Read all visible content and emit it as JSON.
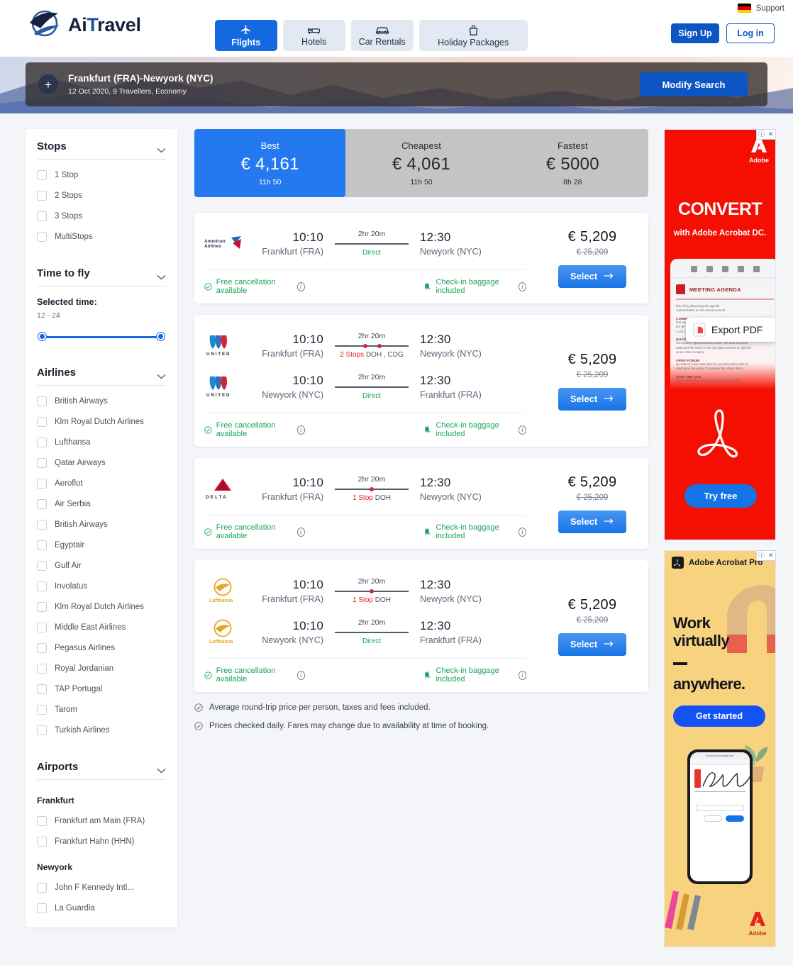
{
  "header": {
    "support_label": "Support",
    "flag_icon": "germany-flag",
    "brand_ai": "Ai",
    "brand_t": "T",
    "brand_ravel": "ravel",
    "tabs": [
      {
        "label": "Flights",
        "icon": "plane-icon",
        "active": true
      },
      {
        "label": "Hotels",
        "icon": "bed-icon",
        "active": false
      },
      {
        "label": "Car Rentals",
        "icon": "car-icon",
        "active": false
      },
      {
        "label": "Holiday Packages",
        "icon": "bag-icon",
        "active": false
      }
    ],
    "sign_up": "Sign Up",
    "log_in": "Log in"
  },
  "hero": {
    "add_icon": "plus-icon",
    "route": "Frankfurt (FRA)-Newyork (NYC)",
    "details": "12 Oct 2020, 9 Travellers, Economy",
    "modify_button": "Modify Search"
  },
  "sidebar": {
    "stops": {
      "title": "Stops",
      "options": [
        "1 Stop",
        "2 Stops",
        "3 Stops",
        "MultiStops"
      ]
    },
    "time_to_fly": {
      "title": "Time to fly",
      "selected_label": "Selected time:",
      "selected_value": "12 - 24",
      "range_min": 12,
      "range_max": 24
    },
    "airlines": {
      "title": "Airlines",
      "options": [
        "British Airways",
        "Klm Royal Dutch Airlines",
        "Lufthansa",
        "Qatar Airways",
        "Aeroflot",
        "Air Serbia",
        "British Airways",
        "Egyptair",
        "Gulf Air",
        "Involatus",
        "Klm Royal Dutch Airlines",
        "Middle East Airlines",
        "Pegasus Airlines",
        "Royal Jordanian",
        "TAP Portugal",
        "Tarom",
        "Turkish Airlines"
      ]
    },
    "airports": {
      "title": "Airports",
      "groups": [
        {
          "city": "Frankfurt",
          "options": [
            "Frankfurt am Main (FRA)",
            "Frankfurt Hahn (HHN)"
          ]
        },
        {
          "city": "Newyork",
          "options": [
            "John F Kennedy Intl...",
            "La Guardia"
          ]
        }
      ]
    }
  },
  "price_tabs": [
    {
      "label": "Best",
      "price": "€ 4,161",
      "duration": "11h 50",
      "active": true
    },
    {
      "label": "Cheapest",
      "price": "€ 4,061",
      "duration": "11h 50",
      "active": false
    },
    {
      "label": "Fastest",
      "price": "€ 5000",
      "duration": "8h 28",
      "active": false
    }
  ],
  "flights": [
    {
      "airline": "American Airlines",
      "airline_logo": "american-airlines-logo",
      "legs": [
        {
          "depart_time": "10:10",
          "depart_city": "Frankfurt (FRA)",
          "duration": "2hr 20m",
          "stops_label": "Direct",
          "stops_count": 0,
          "stop_codes": "",
          "arrive_time": "12:30",
          "arrive_city": "Newyork (NYC)"
        }
      ],
      "price": "€ 5,209",
      "price_old": "€ 25,209",
      "select_label": "Select",
      "features": [
        {
          "text": "Free cancellation available",
          "icon": "check-circle-icon"
        },
        {
          "text": "Check-in baggage included",
          "icon": "baggage-icon"
        }
      ]
    },
    {
      "airline": "United",
      "airline_logo": "united-logo",
      "legs": [
        {
          "depart_time": "10:10",
          "depart_city": "Frankfurt (FRA)",
          "duration": "2hr 20m",
          "stops_label": "2 Stops",
          "stops_count": 2,
          "stop_codes": "DOH , CDG",
          "arrive_time": "12:30",
          "arrive_city": "Newyork (NYC)"
        },
        {
          "depart_time": "10:10",
          "depart_city": "Newyork (NYC)",
          "duration": "2hr 20m",
          "stops_label": "Direct",
          "stops_count": 0,
          "stop_codes": "",
          "arrive_time": "12:30",
          "arrive_city": "Frankfurt (FRA)"
        }
      ],
      "price": "€ 5,209",
      "price_old": "€ 25,209",
      "select_label": "Select",
      "features": [
        {
          "text": "Free cancellation available",
          "icon": "check-circle-icon"
        },
        {
          "text": "Check-in baggage included",
          "icon": "baggage-icon"
        }
      ]
    },
    {
      "airline": "Delta",
      "airline_logo": "delta-logo",
      "legs": [
        {
          "depart_time": "10:10",
          "depart_city": "Frankfurt (FRA)",
          "duration": "2hr 20m",
          "stops_label": "1 Stop",
          "stops_count": 1,
          "stop_codes": "DOH",
          "arrive_time": "12:30",
          "arrive_city": "Newyork (NYC)"
        }
      ],
      "price": "€ 5,209",
      "price_old": "€ 25,209",
      "select_label": "Select",
      "features": [
        {
          "text": "Free cancellation available",
          "icon": "check-circle-icon"
        },
        {
          "text": "Check-in baggage included",
          "icon": "baggage-icon"
        }
      ]
    },
    {
      "airline": "Lufthansa",
      "airline_logo": "lufthansa-logo",
      "legs": [
        {
          "depart_time": "10:10",
          "depart_city": "Frankfurt (FRA)",
          "duration": "2hr 20m",
          "stops_label": "1 Stop",
          "stops_count": 1,
          "stop_codes": "DOH",
          "arrive_time": "12:30",
          "arrive_city": "Newyork (NYC)"
        },
        {
          "depart_time": "10:10",
          "depart_city": "Newyork (NYC)",
          "duration": "2hr 20m",
          "stops_label": "Direct",
          "stops_count": 0,
          "stop_codes": "",
          "arrive_time": "12:30",
          "arrive_city": "Frankfurt (FRA)"
        }
      ],
      "price": "€ 5,209",
      "price_old": "€ 25,209",
      "select_label": "Select",
      "features": [
        {
          "text": "Free cancellation available",
          "icon": "check-circle-icon"
        },
        {
          "text": "Check-in baggage included",
          "icon": "baggage-icon"
        }
      ]
    }
  ],
  "notes": [
    "Average round-trip price per person, taxes and fees included.",
    "Prices checked daily. Fares may change due to availability at time of booking."
  ],
  "ads": [
    {
      "brand": "Adobe",
      "headline": "CONVERT",
      "subline": "with Adobe Acrobat DC.",
      "doc_title": "MEETING AGENDA",
      "chip_label": "Export PDF",
      "cta": "Try free",
      "info_icon": "info-icon",
      "close_icon": "close-icon"
    },
    {
      "brand": "Adobe Acrobat Pro",
      "headline_line1": "Work",
      "headline_line2": "virtually",
      "headline_line3": "anywhere.",
      "cta": "Get started",
      "phone_url": "secure.na3.echosign.com",
      "footer_brand": "Adobe",
      "info_icon": "info-icon",
      "close_icon": "close-icon"
    }
  ],
  "colors": {
    "primary_blue": "#1569e0",
    "deep_blue": "#0c55c4",
    "green": "#18a558",
    "red": "#e02030",
    "ad_red": "#f40f02",
    "ad_yellow": "#f7d27f"
  }
}
